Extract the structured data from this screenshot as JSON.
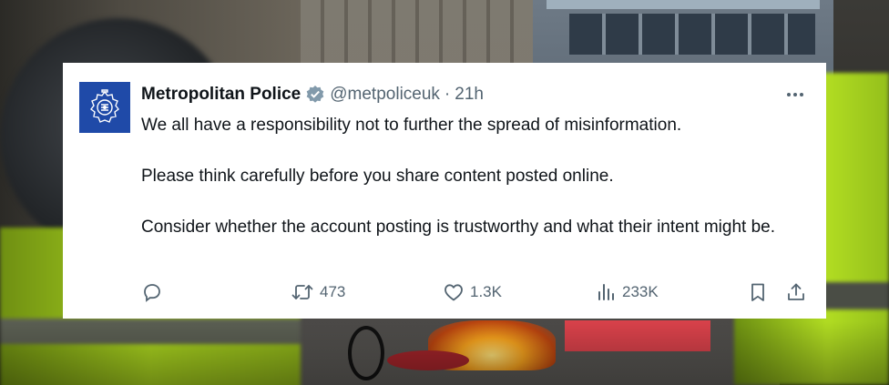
{
  "tweet": {
    "author_name": "Metropolitan Police",
    "handle": "@metpoliceuk",
    "separator": "·",
    "time": "21h",
    "paragraphs": [
      "We all have a responsibility not to further the spread of misinformation.",
      "Please think carefully before you share content posted online.",
      "Consider whether the account posting is trustworthy and what their intent might be."
    ],
    "stats": {
      "retweets": "473",
      "likes": "1.3K",
      "views": "233K"
    },
    "icons": {
      "avatar": "met-police-crest-logo",
      "verified": "verified-badge-icon",
      "more": "more-options-icon",
      "reply": "reply-icon",
      "retweet": "retweet-icon",
      "like": "heart-icon",
      "views": "views-bar-chart-icon",
      "bookmark": "bookmark-icon",
      "share": "share-icon"
    },
    "colors": {
      "avatar_bg": "#1f4aa8",
      "text": "#0f1419",
      "muted": "#536471",
      "verified_badge": "#829aab"
    }
  }
}
